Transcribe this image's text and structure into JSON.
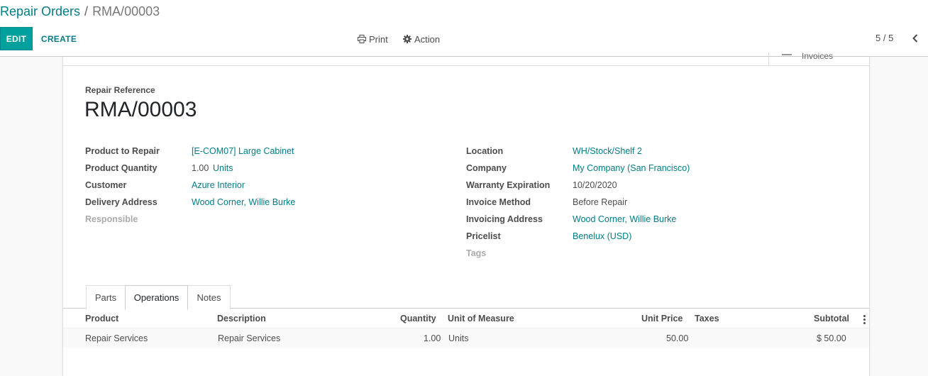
{
  "breadcrumb": {
    "parent": "Repair Orders",
    "separator": "/",
    "current": "RMA/00003"
  },
  "toolbar": {
    "edit_label": "EDIT",
    "create_label": "CREATE",
    "print_label": "Print",
    "action_label": "Action",
    "pager": "5 / 5"
  },
  "button_box": {
    "invoices_label": "Invoices"
  },
  "form": {
    "reference_label": "Repair Reference",
    "reference_value": "RMA/00003",
    "left_fields": [
      {
        "label": "Product to Repair",
        "value": "[E-COM07] Large Cabinet"
      },
      {
        "label": "Product Quantity",
        "value": "1.00",
        "unit": "Units"
      },
      {
        "label": "Customer",
        "value": "Azure Interior"
      },
      {
        "label": "Delivery Address",
        "value": "Wood Corner, Willie Burke"
      },
      {
        "label": "Responsible",
        "value": ""
      }
    ],
    "right_fields": [
      {
        "label": "Location",
        "value": "WH/Stock/Shelf 2"
      },
      {
        "label": "Company",
        "value": "My Company (San Francisco)"
      },
      {
        "label": "Warranty Expiration",
        "value": "10/20/2020"
      },
      {
        "label": "Invoice Method",
        "value": "Before Repair"
      },
      {
        "label": "Invoicing Address",
        "value": "Wood Corner, Willie Burke"
      },
      {
        "label": "Pricelist",
        "value": "Benelux (USD)"
      },
      {
        "label": "Tags",
        "value": ""
      }
    ]
  },
  "tabs": [
    {
      "label": "Parts"
    },
    {
      "label": "Operations"
    },
    {
      "label": "Notes"
    }
  ],
  "active_tab": "Operations",
  "operations_table": {
    "columns": [
      "Product",
      "Description",
      "Quantity",
      "Unit of Measure",
      "Unit Price",
      "Taxes",
      "Subtotal"
    ],
    "rows": [
      {
        "product": "Repair Services",
        "description": "Repair Services",
        "quantity": "1.00",
        "uom": "Units",
        "unit_price": "50.00",
        "taxes": "",
        "subtotal": "$ 50.00"
      }
    ]
  },
  "colors": {
    "primary": "#00a09d",
    "link": "#017e84",
    "text": "#4c4c4c"
  }
}
